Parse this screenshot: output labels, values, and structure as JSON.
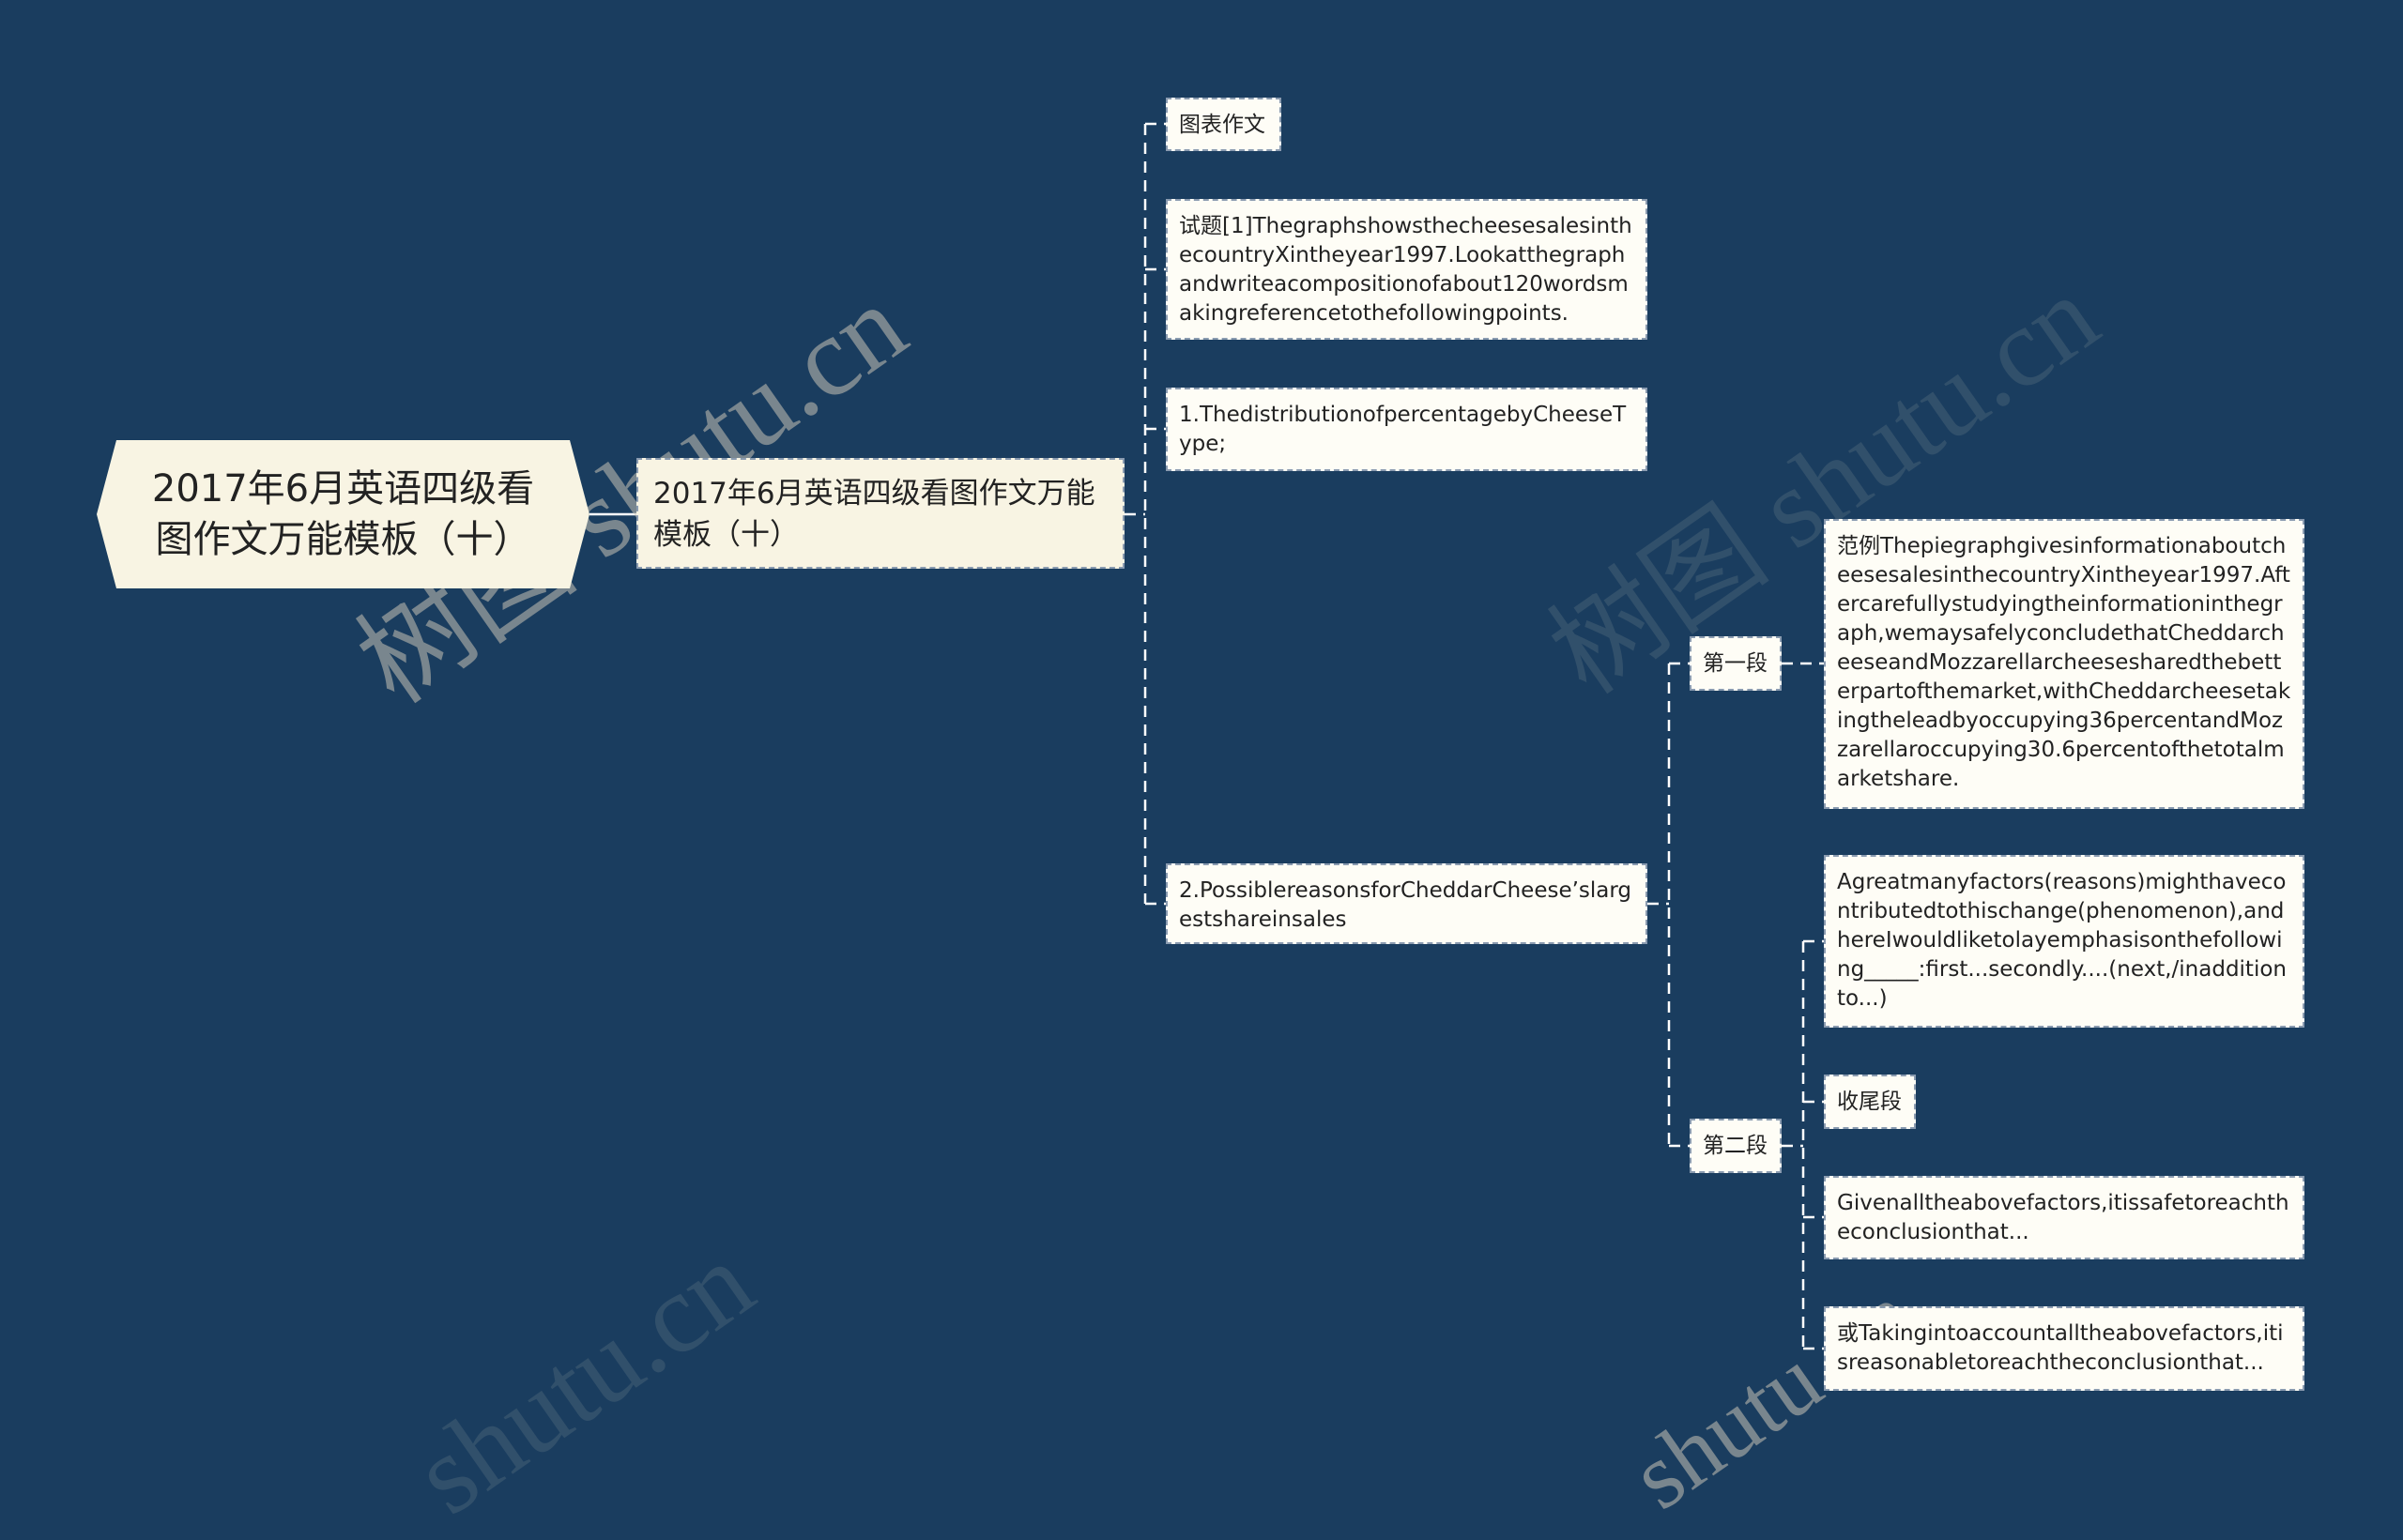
{
  "root": {
    "label": "2017年6月英语四级看图作文万能模板（十）"
  },
  "level1": {
    "label": "2017年6月英语四级看图作文万能模板（十）"
  },
  "level2": [
    {
      "label": "图表作文"
    },
    {
      "label": "试题[1]ThegraphshowsthecheesesalesinthecountryXintheyear1997.Lookatthegraphandwriteacompositionofabout120wordsmakingreferencetothefollowingpoints."
    },
    {
      "label": "1.ThedistributionofpercentagebyCheeseType;"
    },
    {
      "label": "2.PossiblereasonsforCheddarCheese’slargestshareinsales"
    }
  ],
  "level3": [
    {
      "label": "第一段"
    },
    {
      "label": "第二段"
    }
  ],
  "level4": [
    {
      "label": "范例ThepiegraphgivesinformationaboutcheesesalesinthecountryXintheyear1997.Aftercarefullystudyingtheinformationinthegraph,wemaysafelyconcludethatCheddarcheeseandMozzarellarcheesesharedthebetterpartofthemarket,withCheddarcheesetakingtheleadbyoccupying36percentandMozzarellaroccupying30.6percentofthetotalmarketshare."
    },
    {
      "label": "Agreatmanyfactors(reasons)mighthavecontributedtothischange(phenomenon),andhereIwouldliketolayemphasisonthefollowing_____:first...secondly....(next,/inadditionto...)"
    },
    {
      "label": "收尾段"
    },
    {
      "label": "Givenalltheabovefactors,itissafetoreachtheconclusionthat..."
    },
    {
      "label": "或Takingintoaccountalltheabovefactors,itisreasonabletoreachtheconclusionthat..."
    }
  ],
  "watermark": {
    "text_cn": "树图",
    "text_en": "shutu.cn"
  },
  "colors": {
    "background": "#1a3d5f",
    "node_fill": "#fefdf6",
    "root_fill": "#f8f4e3",
    "connector": "#ffffff"
  }
}
